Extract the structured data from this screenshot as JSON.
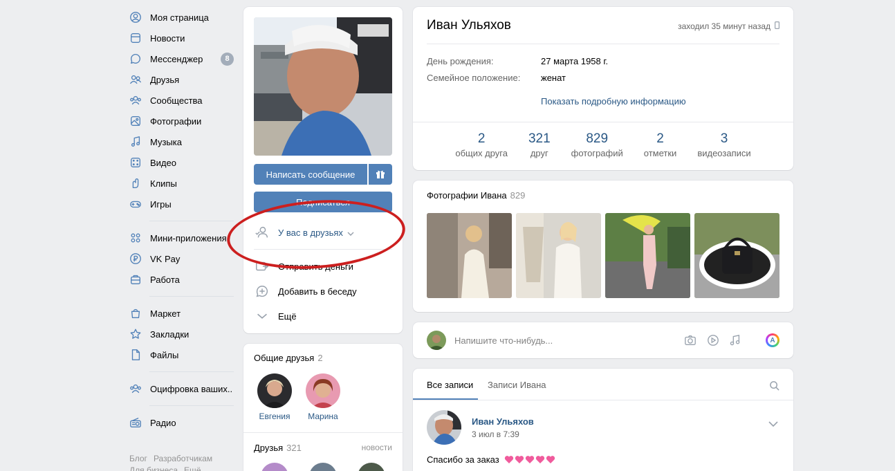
{
  "sidebar": {
    "items": [
      {
        "label": "Моя страница",
        "icon": "user-circle-icon"
      },
      {
        "label": "Новости",
        "icon": "news-icon"
      },
      {
        "label": "Мессенджер",
        "icon": "chat-bubble-icon",
        "badge": "8"
      },
      {
        "label": "Друзья",
        "icon": "friends-icon"
      },
      {
        "label": "Сообщества",
        "icon": "communities-icon"
      },
      {
        "label": "Фотографии",
        "icon": "photo-icon"
      },
      {
        "label": "Музыка",
        "icon": "music-note-icon"
      },
      {
        "label": "Видео",
        "icon": "video-icon"
      },
      {
        "label": "Клипы",
        "icon": "clips-icon"
      },
      {
        "label": "Игры",
        "icon": "gamepad-icon"
      }
    ],
    "items2": [
      {
        "label": "Мини-приложения",
        "icon": "mini-apps-icon"
      },
      {
        "label": "VK Pay",
        "icon": "vk-pay-icon"
      },
      {
        "label": "Работа",
        "icon": "briefcase-icon"
      }
    ],
    "items3": [
      {
        "label": "Маркет",
        "icon": "shopping-bag-icon"
      },
      {
        "label": "Закладки",
        "icon": "star-icon"
      },
      {
        "label": "Файлы",
        "icon": "file-icon"
      }
    ],
    "items4": [
      {
        "label": "Оцифровка ваших..",
        "icon": "group-icon"
      }
    ],
    "items5": [
      {
        "label": "Радио",
        "icon": "radio-icon"
      }
    ],
    "footer": [
      "Блог",
      "Разработчикам",
      "Для бизнеса",
      "Ещё"
    ]
  },
  "profile": {
    "write_message": "Написать сообщение",
    "subscribe": "Подписаться",
    "actions": [
      {
        "label": "У вас в друзьях",
        "icon": "user-check-icon"
      },
      {
        "label": "Отправить деньги",
        "icon": "money-transfer-icon"
      },
      {
        "label": "Добавить в беседу",
        "icon": "chat-add-icon"
      },
      {
        "label": "Ещё",
        "icon": "chevron-down-icon"
      }
    ]
  },
  "common_friends": {
    "title": "Общие друзья",
    "count": "2",
    "friends": [
      "Евгения",
      "Марина"
    ]
  },
  "friends": {
    "title": "Друзья",
    "count": "321",
    "updates_link": "новости"
  },
  "info": {
    "name": "Иван Ульяхов",
    "online": "заходил 35 минут назад",
    "birthday_label": "День рождения:",
    "birthday_value": "27 марта 1958 г.",
    "family_label": "Семейное положение:",
    "family_value": "женат",
    "show_more": "Показать подробную информацию",
    "counters": [
      {
        "num": "2",
        "label": "общих друга"
      },
      {
        "num": "321",
        "label": "друг"
      },
      {
        "num": "829",
        "label": "фотографий"
      },
      {
        "num": "2",
        "label": "отметки"
      },
      {
        "num": "3",
        "label": "видеозаписи"
      }
    ]
  },
  "photos": {
    "title": "Фотографии Ивана",
    "count": "829"
  },
  "post_input": {
    "placeholder": "Напишите что-нибудь..."
  },
  "wall": {
    "tab_all": "Все записи",
    "tab_owner": "Записи Ивана",
    "post": {
      "author": "Иван Ульяхов",
      "date": "3 июл в 7:39",
      "text": "Спасибо за заказ"
    }
  },
  "colors": {
    "accent": "#5181b8",
    "link": "#2a5885",
    "highlight_ellipse": "#cc1f1f"
  }
}
